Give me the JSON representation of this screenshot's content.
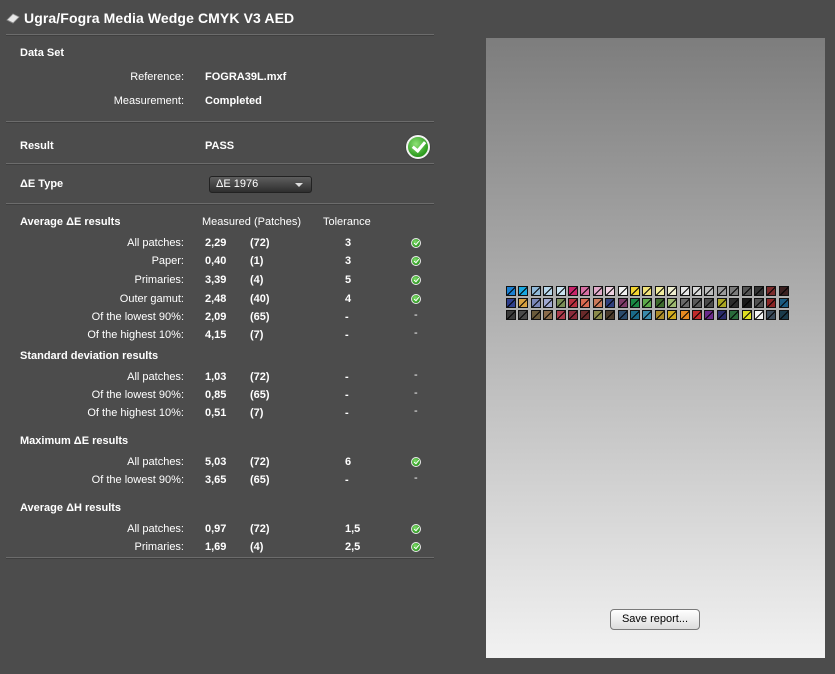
{
  "title": "Ugra/Fogra Media Wedge CMYK V3 AED",
  "data_set": {
    "heading": "Data Set",
    "reference_label": "Reference:",
    "reference_value": "FOGRA39L.mxf",
    "measurement_label": "Measurement:",
    "measurement_value": "Completed"
  },
  "result": {
    "label": "Result",
    "value": "PASS",
    "status_icon": "check-circle-icon"
  },
  "delta_e_type": {
    "label": "ΔE Type",
    "selected": "ΔE 1976"
  },
  "columns": {
    "measured": "Measured (Patches)",
    "tolerance": "Tolerance"
  },
  "avg_de": {
    "heading": "Average ΔE results",
    "rows": [
      {
        "label": "All patches:",
        "value": "2,29",
        "patches": "(72)",
        "tolerance": "3",
        "status": "check"
      },
      {
        "label": "Paper:",
        "value": "0,40",
        "patches": "(1)",
        "tolerance": "3",
        "status": "check"
      },
      {
        "label": "Primaries:",
        "value": "3,39",
        "patches": "(4)",
        "tolerance": "5",
        "status": "check"
      },
      {
        "label": "Outer gamut:",
        "value": "2,48",
        "patches": "(40)",
        "tolerance": "4",
        "status": "check"
      },
      {
        "label": "Of the lowest 90%:",
        "value": "2,09",
        "patches": "(65)",
        "tolerance": "-",
        "status": "-"
      },
      {
        "label": "Of the highest 10%:",
        "value": "4,15",
        "patches": "(7)",
        "tolerance": "-",
        "status": "-"
      }
    ]
  },
  "std_dev": {
    "heading": "Standard deviation results",
    "rows": [
      {
        "label": "All patches:",
        "value": "1,03",
        "patches": "(72)",
        "tolerance": "-",
        "status": "-"
      },
      {
        "label": "Of the lowest 90%:",
        "value": "0,85",
        "patches": "(65)",
        "tolerance": "-",
        "status": "-"
      },
      {
        "label": "Of the highest 10%:",
        "value": "0,51",
        "patches": "(7)",
        "tolerance": "-",
        "status": "-"
      }
    ]
  },
  "max_de": {
    "heading": "Maximum ΔE results",
    "rows": [
      {
        "label": "All patches:",
        "value": "5,03",
        "patches": "(72)",
        "tolerance": "6",
        "status": "check"
      },
      {
        "label": "Of the lowest 90%:",
        "value": "3,65",
        "patches": "(65)",
        "tolerance": "-",
        "status": "-"
      }
    ]
  },
  "avg_dh": {
    "heading": "Average ΔH results",
    "rows": [
      {
        "label": "All patches:",
        "value": "0,97",
        "patches": "(72)",
        "tolerance": "1,5",
        "status": "check"
      },
      {
        "label": "Primaries:",
        "value": "1,69",
        "patches": "(4)",
        "tolerance": "2,5",
        "status": "check"
      }
    ]
  },
  "save_button": "Save report...",
  "patch_colors": [
    [
      "#1a7fd1",
      "#1aa8e0",
      "#8fb8d8",
      "#b7d6ea",
      "#c9e2ef",
      "#c8246a",
      "#d66ea2",
      "#e0a9c8",
      "#efd2e2",
      "#f0f0f0",
      "#f2d431",
      "#f1e27a",
      "#f1ec9e",
      "#eeeed0",
      "#e6e6e6",
      "#d8d8d8",
      "#bcbcbc",
      "#9a9a9a",
      "#7a7a7a",
      "#555555",
      "#333333",
      "#7a2a2a",
      "#3a2020"
    ],
    [
      "#2e3e8c",
      "#d8a040",
      "#7a86b8",
      "#a0a8d0",
      "#7a8e56",
      "#b83040",
      "#d86a50",
      "#cc7a5a",
      "#2e3e7c",
      "#7e3c68",
      "#1a8a44",
      "#5eaa4a",
      "#3c6a2c",
      "#9cb870",
      "#6a6a6a",
      "#5a5a5a",
      "#4a4a4a",
      "#aaa622",
      "#2a2a2a",
      "#1a1a1a",
      "#505050",
      "#8a2424",
      "#1a5a80"
    ],
    [
      "#3a3a3a",
      "#4a4a4a",
      "#6a5a3a",
      "#8a6a4a",
      "#aa3a4a",
      "#8a2a3a",
      "#6a2a2a",
      "#8a8a4a",
      "#4a3a2a",
      "#2a4a6a",
      "#1a6a8a",
      "#3a8aaa",
      "#aa8a2a",
      "#d0aa20",
      "#e88a20",
      "#c02a2a",
      "#6a2a8a",
      "#2a2a6a",
      "#2a6a3a",
      "#e0e020",
      "#f4f4f4",
      "#3a4a5a",
      "#1a3a4a"
    ]
  ]
}
